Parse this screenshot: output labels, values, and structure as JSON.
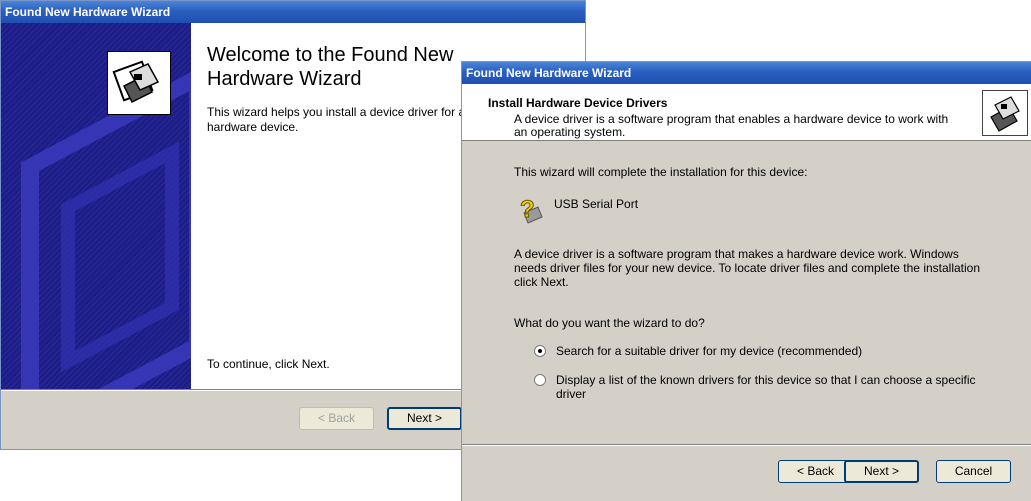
{
  "wizard_back": {
    "title": "Found New Hardware Wizard",
    "welcome_heading": "Welcome to the Found New Hardware Wizard",
    "description": "This wizard helps you install a device driver for a hardware device.",
    "continue_text": "To continue, click Next.",
    "back_label": "< Back",
    "next_label": "Next >",
    "icon": "hardware-icon"
  },
  "wizard_front": {
    "title": "Found New Hardware Wizard",
    "header_title": "Install Hardware Device Drivers",
    "header_subtitle": "A device driver is a software program that enables a hardware device to work with an operating system.",
    "intro": "This wizard will complete the installation for this device:",
    "device_name": "USB Serial Port",
    "device_icon": "unknown-device-question-icon",
    "paragraph": "A device driver is a software program that makes a hardware device work. Windows needs driver files for your new device. To locate driver files and complete the installation click Next.",
    "question": "What do you want the wizard to do?",
    "options": [
      {
        "label": "Search for a suitable driver for my device (recommended)",
        "selected": true
      },
      {
        "label": "Display a list of the known drivers for this device so that I can choose a specific driver",
        "selected": false
      }
    ],
    "back_label": "< Back",
    "next_label": "Next >",
    "cancel_label": "Cancel"
  },
  "colors": {
    "titlebar": "#2a5fc0",
    "left_panel": "#1d1d8a",
    "dialog_bg": "#d4d0c8"
  }
}
